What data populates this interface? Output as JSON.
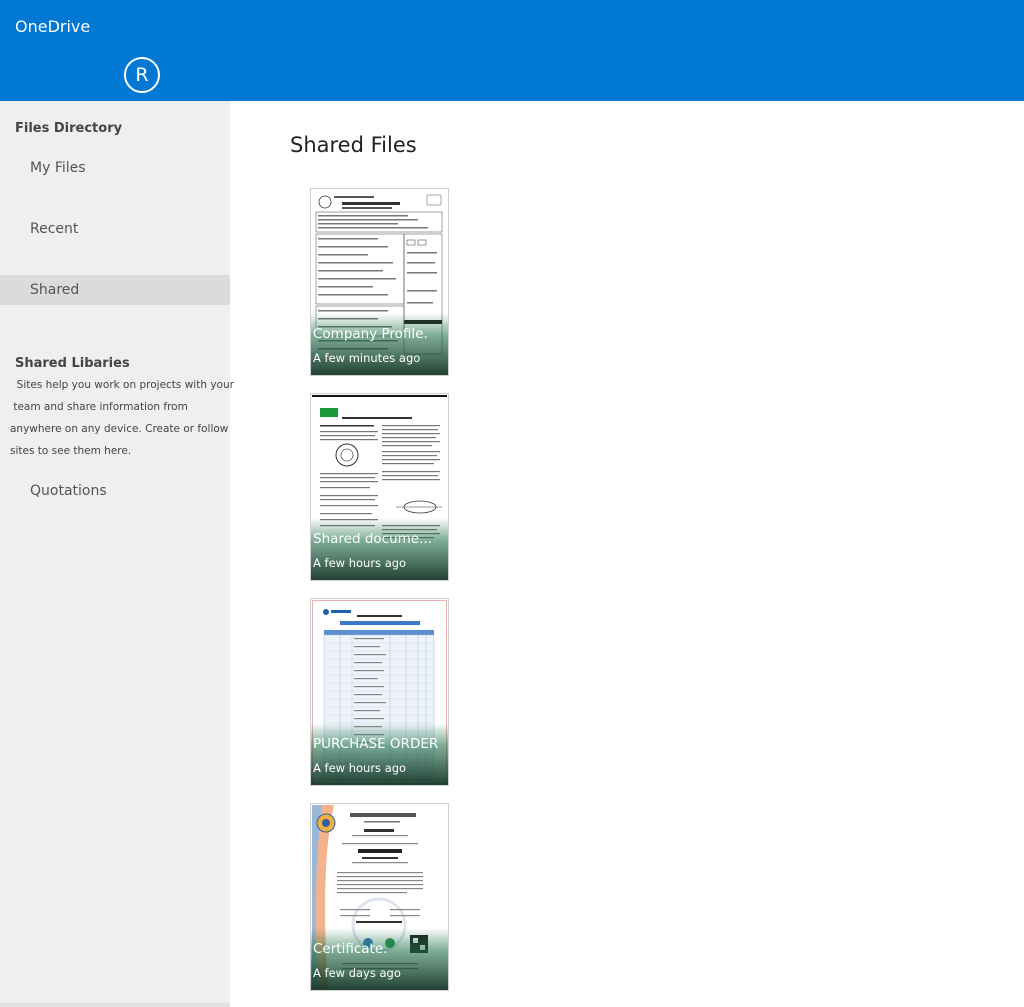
{
  "app": {
    "title": "OneDrive",
    "avatar_initial": "R"
  },
  "sidebar": {
    "files_heading": "Files Directory",
    "items": [
      {
        "label": "My Files",
        "active": false
      },
      {
        "label": "Recent",
        "active": false
      },
      {
        "label": "Shared",
        "active": true
      }
    ],
    "libraries_heading": "Shared Libaries",
    "libraries_description": [
      "  Sites help you work on projects with your",
      " team and share information from",
      "anywhere on any device. Create or follow",
      "sites to see them here."
    ],
    "library_items": [
      {
        "label": "Quotations"
      }
    ]
  },
  "main": {
    "title": "Shared Files",
    "files": [
      {
        "name": "Company Profile.",
        "time": "A few minutes ago",
        "thumbnail": "form-document"
      },
      {
        "name": "Shared docume...",
        "time": "A few hours ago",
        "thumbnail": "exam-document"
      },
      {
        "name": "PURCHASE ORDER",
        "time": "A few hours ago",
        "thumbnail": "product-list-table"
      },
      {
        "name": "Certificate.",
        "time": "A few days ago",
        "thumbnail": "iso-certificate"
      }
    ]
  },
  "colors": {
    "accent": "#0078d4",
    "sidebar_bg": "#f0efef",
    "active_item_bg": "#dcdbdb"
  }
}
